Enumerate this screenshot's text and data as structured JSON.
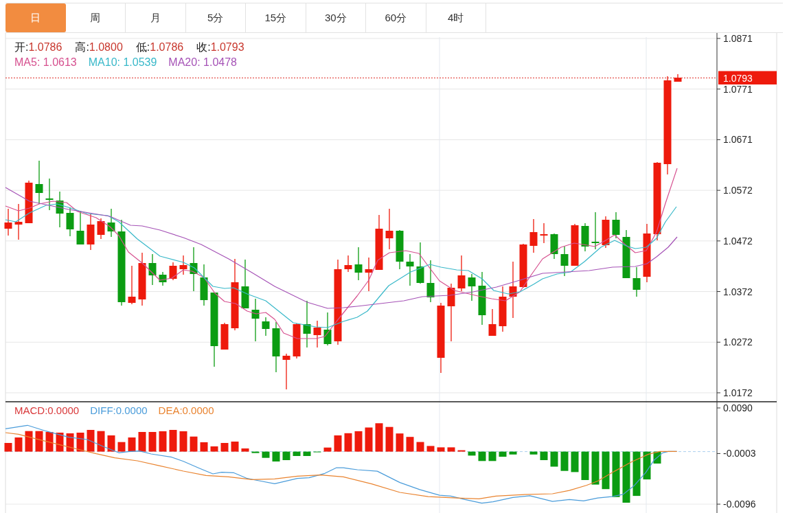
{
  "tabs": [
    {
      "label": "日",
      "selected": true
    },
    {
      "label": "周",
      "selected": false
    },
    {
      "label": "月",
      "selected": false
    },
    {
      "label": "5分",
      "selected": false
    },
    {
      "label": "15分",
      "selected": false
    },
    {
      "label": "30分",
      "selected": false
    },
    {
      "label": "60分",
      "selected": false
    },
    {
      "label": "4时",
      "selected": false
    }
  ],
  "price_panel": {
    "legend": {
      "ohlc": [
        {
          "label": "开:",
          "value": "1.0786"
        },
        {
          "label": "高:",
          "value": "1.0800"
        },
        {
          "label": "低:",
          "value": "1.0786"
        },
        {
          "label": "收:",
          "value": "1.0793"
        }
      ],
      "ma": [
        {
          "text": "MA5: 1.0613",
          "color": "#d6508f"
        },
        {
          "text": "MA10: 1.0539",
          "color": "#38b8c9"
        },
        {
          "text": "MA20: 1.0478",
          "color": "#a552b6"
        }
      ]
    },
    "axis_ticks": [
      "1.0871",
      "1.0771",
      "1.0671",
      "1.0572",
      "1.0472",
      "1.0372",
      "1.0272",
      "1.0172"
    ],
    "last_price": "1.0793"
  },
  "macd_panel": {
    "legend": [
      {
        "text": "MACD:0.0000",
        "color": "#d9383a"
      },
      {
        "text": "DIFF:0.0000",
        "color": "#4a9cda"
      },
      {
        "text": "DEA:0.0000",
        "color": "#e9832f"
      }
    ],
    "axis_ticks": [
      "0.0090",
      "-0.0003",
      "-0.0096"
    ]
  }
}
